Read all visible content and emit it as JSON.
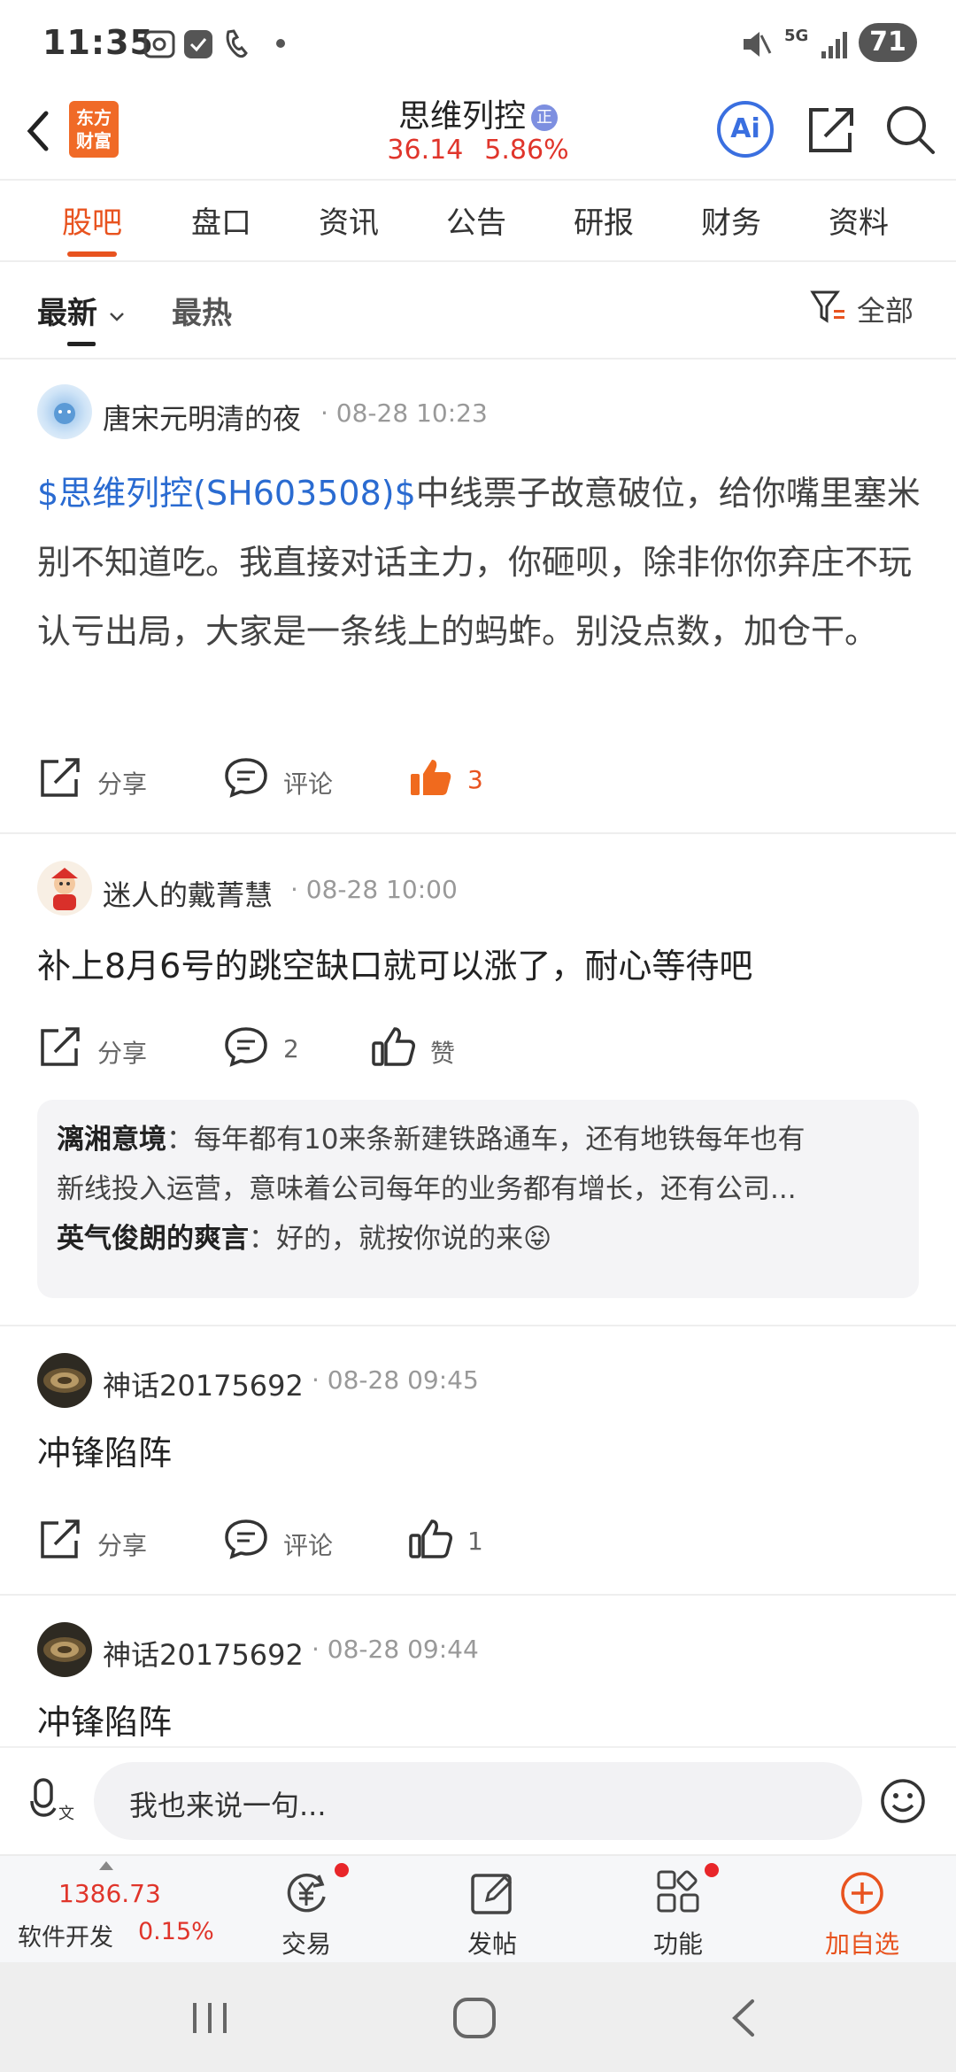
{
  "status_bar": {
    "time": "11:35",
    "network": "5G",
    "battery": "71"
  },
  "header": {
    "logo_text": "东方财富",
    "stock_name": "思维列控",
    "badge": "正",
    "price": "36.14",
    "change_pct": "5.86%",
    "ai_label": "Ai"
  },
  "tabs": [
    "股吧",
    "盘口",
    "资讯",
    "公告",
    "研报",
    "财务",
    "资料"
  ],
  "filter": {
    "newest": "最新",
    "hottest": "最热",
    "all": "全部"
  },
  "posts": [
    {
      "user": "唐宋元明清的夜",
      "time": "· 08-28 10:23",
      "tag": "$思维列控(SH603508)$",
      "text": "中线票子故意破位，给你嘴里塞米别不知道吃。我直接对话主力，你砸呗，除非你你弃庄不玩认亏出局，大家是一条线上的蚂蚱。别没点数，加仓干。",
      "share": "分享",
      "comment": "评论",
      "likes": "3"
    },
    {
      "user": "迷人的戴菁慧",
      "time": "· 08-28 10:00",
      "text": "补上8月6号的跳空缺口就可以涨了，耐心等待吧",
      "share": "分享",
      "comment": "2",
      "likes": "赞",
      "replies": [
        {
          "user": "漓湘意境",
          "text": "：每年都有10来条新建铁路通车，还有地铁每年也有"
        },
        {
          "user": "",
          "text": "新线投入运营，意味着公司每年的业务都有增长，还有公司..."
        },
        {
          "user": "英气俊朗的爽言",
          "text": "：好的，就按你说的来😝"
        }
      ]
    },
    {
      "user": "神话20175692",
      "time": "· 08-28 09:45",
      "text": "冲锋陷阵",
      "share": "分享",
      "comment": "评论",
      "likes": "1"
    },
    {
      "user": "神话20175692",
      "time": "· 08-28 09:44",
      "text": "冲锋陷阵"
    }
  ],
  "input": {
    "placeholder": "我也来说一句..."
  },
  "bottom_nav": {
    "index_value": "1386.73",
    "index_name": "软件开发",
    "index_pct": "0.15%",
    "items": [
      "交易",
      "发帖",
      "功能",
      "加自选"
    ]
  },
  "colors": {
    "accent": "#e8531f",
    "up": "#e0352b",
    "link": "#2a6bd1"
  }
}
